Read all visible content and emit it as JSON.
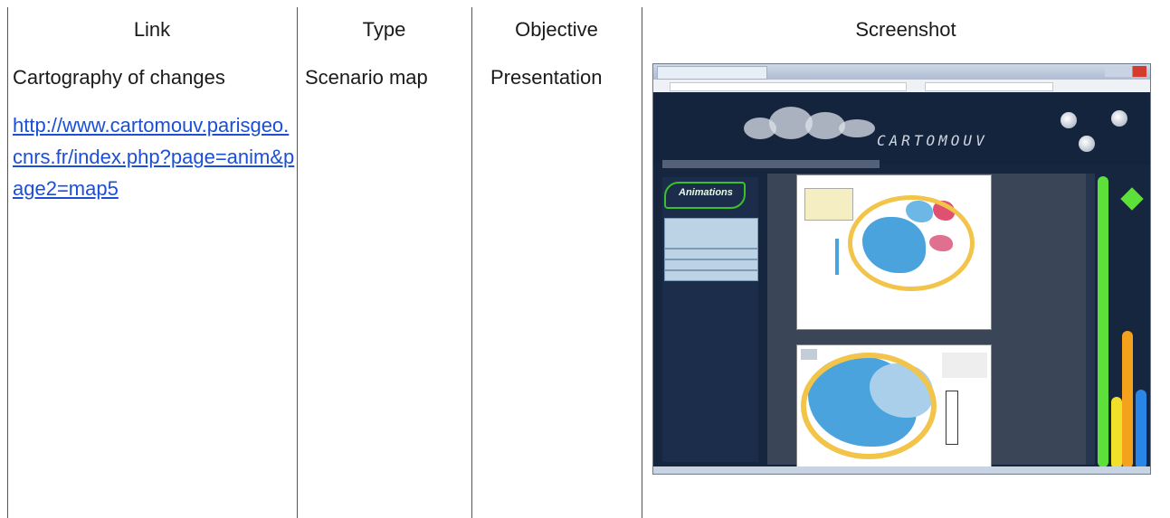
{
  "headers": {
    "link": "Link",
    "type": "Type",
    "objective": "Objective",
    "screenshot": "Screenshot"
  },
  "row": {
    "link_name": "Cartography of changes",
    "link_url": "http://www.cartomouv.parisgeo.cnrs.fr/index.php?page=anim&page2=map5",
    "type": "Scenario map",
    "objective": "Presentation"
  },
  "screenshot": {
    "site_logo": "CARTOMOUV",
    "sidebar_logo": "Animations",
    "colors": {
      "background": "#16263f",
      "green_bar": "#5ee03a",
      "orange_bar": "#f4a21c",
      "yellow_bar": "#f1e02a",
      "blue_bar": "#2a86e6",
      "map_blue": "#4aa3dd",
      "map_orange": "#f2c44a"
    }
  }
}
